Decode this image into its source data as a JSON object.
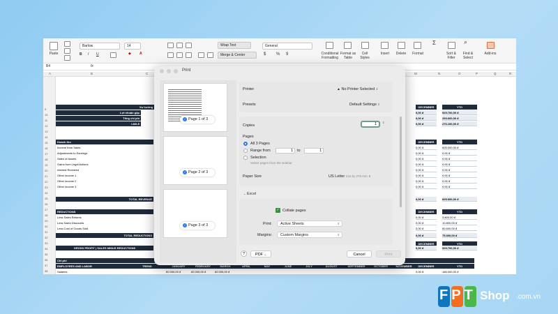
{
  "ribbon": {
    "paste": "Paste",
    "font_name": "Barlow",
    "font_size": "14",
    "wrap_text": "Wrap Text",
    "merge_center": "Merge & Center",
    "number_format": "General",
    "cond_format": "Conditional Formatting",
    "format_table": "Format as Table",
    "cell_styles": "Cell Styles",
    "insert": "Insert",
    "delete": "Delete",
    "format": "Format",
    "sort_filter": "Sort & Filter",
    "find_select": "Find & Select",
    "addins": "Add-ins"
  },
  "formula_bar": {
    "name_box": "B4",
    "fx": "fx"
  },
  "columns": [
    "A",
    "B",
    "C",
    "M",
    "N",
    "O",
    "P",
    "Q",
    "R"
  ],
  "rows": [
    "9",
    "10",
    "11",
    "12",
    "13",
    "14",
    "15",
    "16",
    "17",
    "18",
    "19",
    "20",
    "21",
    "22",
    "23",
    "24",
    "25",
    "26",
    "27",
    "28",
    "29",
    "30",
    "31",
    "32",
    "33",
    "34",
    "35",
    "36",
    "37",
    "38",
    "39",
    "40",
    "41",
    "42",
    "43"
  ],
  "sheet": {
    "top_header": "Xu hướng",
    "summary": [
      {
        "label": "Lợi nhuận gộp",
        "dec": "0,00 đ",
        "ytd": "529.700,00 đ"
      },
      {
        "label": "Tổng chi phí",
        "dec": "0,00 đ",
        "ytd": "253.600,00 đ"
      },
      {
        "label": "Lãi/Lỗ",
        "dec": "0,00 đ",
        "ytd": "276.100,00 đ"
      }
    ],
    "december": "DECEMBER",
    "ytd": "YTD",
    "trend": "TREND",
    "income_title": "Doanh thu",
    "income": [
      {
        "label": "Income from Sales",
        "dec": "0,00 đ",
        "ytd": "605.000,00 đ"
      },
      {
        "label": "Adjustments to Earnings",
        "dec": "0,00 đ",
        "ytd": "0,00 đ"
      },
      {
        "label": "Sales of Assets",
        "dec": "0,00 đ",
        "ytd": "0,00 đ"
      },
      {
        "label": "Gains from Legal Actions",
        "dec": "0,00 đ",
        "ytd": "0,00 đ"
      },
      {
        "label": "Interest Received",
        "dec": "0,00 đ",
        "ytd": "0,00 đ"
      },
      {
        "label": "Other income 1",
        "dec": "0,00 đ",
        "ytd": "0,00 đ"
      },
      {
        "label": "Other income 2",
        "dec": "0,00 đ",
        "ytd": "0,00 đ"
      },
      {
        "label": "Other income 3",
        "dec": "0,00 đ",
        "ytd": "0,00 đ"
      }
    ],
    "total_revenue": {
      "label": "TOTAL REVENUE",
      "dec": "0,00 đ",
      "ytd": "605.000,00 đ"
    },
    "reductions_title": "REDUCTIONS",
    "reductions": [
      {
        "label": "Less Sales Returns",
        "dec": "0,00 đ",
        "ytd": "3.800,00 đ"
      },
      {
        "label": "Less Sales Discounts",
        "dec": "0,00 đ",
        "ytd": "10.800,00 đ"
      },
      {
        "label": "Less Cost of Goods Sold",
        "dec": "0,00 đ",
        "ytd": "60.500,00 đ"
      }
    ],
    "total_reductions": {
      "label": "TOTAL REDUCTIONS",
      "dec": "0,00 đ",
      "ytd": "75.300,00 đ"
    },
    "gross_profit": {
      "label": "GROSS PROFIT | SALES MINUS REDUCTIONS",
      "dec": "0,00 đ",
      "ytd": "529.700,00 đ"
    },
    "expenses_title": "Chi phí",
    "employees": "EMPLOYEES AND LABOR",
    "months": [
      "JANUARY",
      "FEBRUARY",
      "MARCH",
      "APRIL",
      "MAY",
      "JUNE",
      "JULY",
      "AUGUST",
      "SEPTEMBER",
      "OCTOBER",
      "NOVEMBER",
      "DECEMBER"
    ],
    "salaries": {
      "label": "Salaries",
      "jan": "82.000,00 đ",
      "feb": "82.000,00 đ",
      "mar": "82.000,00 đ",
      "other": "0,00 đ",
      "ytd": "186.000,00 đ"
    }
  },
  "print_dialog": {
    "title": "Print",
    "pages": [
      "Page 1 of 3",
      "Page 2 of 3",
      "Page 3 of 3"
    ],
    "printer_label": "Printer",
    "printer_value": "No Printer Selected",
    "presets_label": "Presets",
    "presets_value": "Default Settings",
    "copies_label": "Copies",
    "copies_value": "1",
    "pages_label": "Pages",
    "all_pages": "All 3 Pages",
    "range_from": "Range from",
    "range_start": "1",
    "range_to": "to",
    "range_end": "1",
    "selection": "Selection",
    "selection_hint": "Select pages from the sidebar",
    "paper_size_label": "Paper Size",
    "paper_size_value": "US Letter",
    "paper_size_dims": "216 by 279 mm",
    "excel_section": "Excel",
    "collate": "Collate pages",
    "print_label": "Print:",
    "print_value": "Active Sheets",
    "margins_label": "Margins:",
    "margins_value": "Custom Margins",
    "help": "?",
    "pdf": "PDF",
    "cancel": "Cancel",
    "print_button": "Print"
  },
  "logo": {
    "brand": "FPT",
    "shop": "Shop",
    "domain": ".com.vn",
    "colors": [
      "#f26f21",
      "#4bb748",
      "#0f75bd",
      "#ffffff"
    ]
  }
}
